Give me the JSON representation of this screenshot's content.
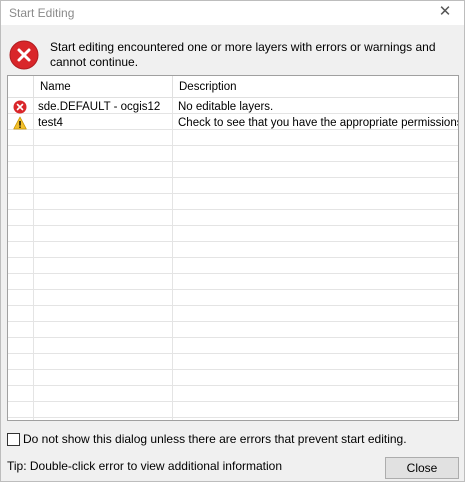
{
  "window": {
    "title": "Start Editing",
    "close_glyph": "✕"
  },
  "message": {
    "icon": "error-icon",
    "text": "Start editing encountered one or more layers with errors or warnings and cannot continue."
  },
  "table": {
    "columns": [
      "Name",
      "Description"
    ],
    "rows": [
      {
        "icon": "error-icon",
        "name": "sde.DEFAULT - ocgis12",
        "description": "No editable layers."
      },
      {
        "icon": "warning-icon",
        "name": "test4",
        "description": "Check to see that you have the appropriate permissions."
      }
    ]
  },
  "checkbox": {
    "label": "Do not show this dialog unless there are errors that prevent start editing.",
    "checked": false
  },
  "tip": "Tip: Double-click error to view additional information",
  "buttons": {
    "close": "Close"
  },
  "colors": {
    "error": "#d9262a",
    "warning": "#f3c02c"
  }
}
